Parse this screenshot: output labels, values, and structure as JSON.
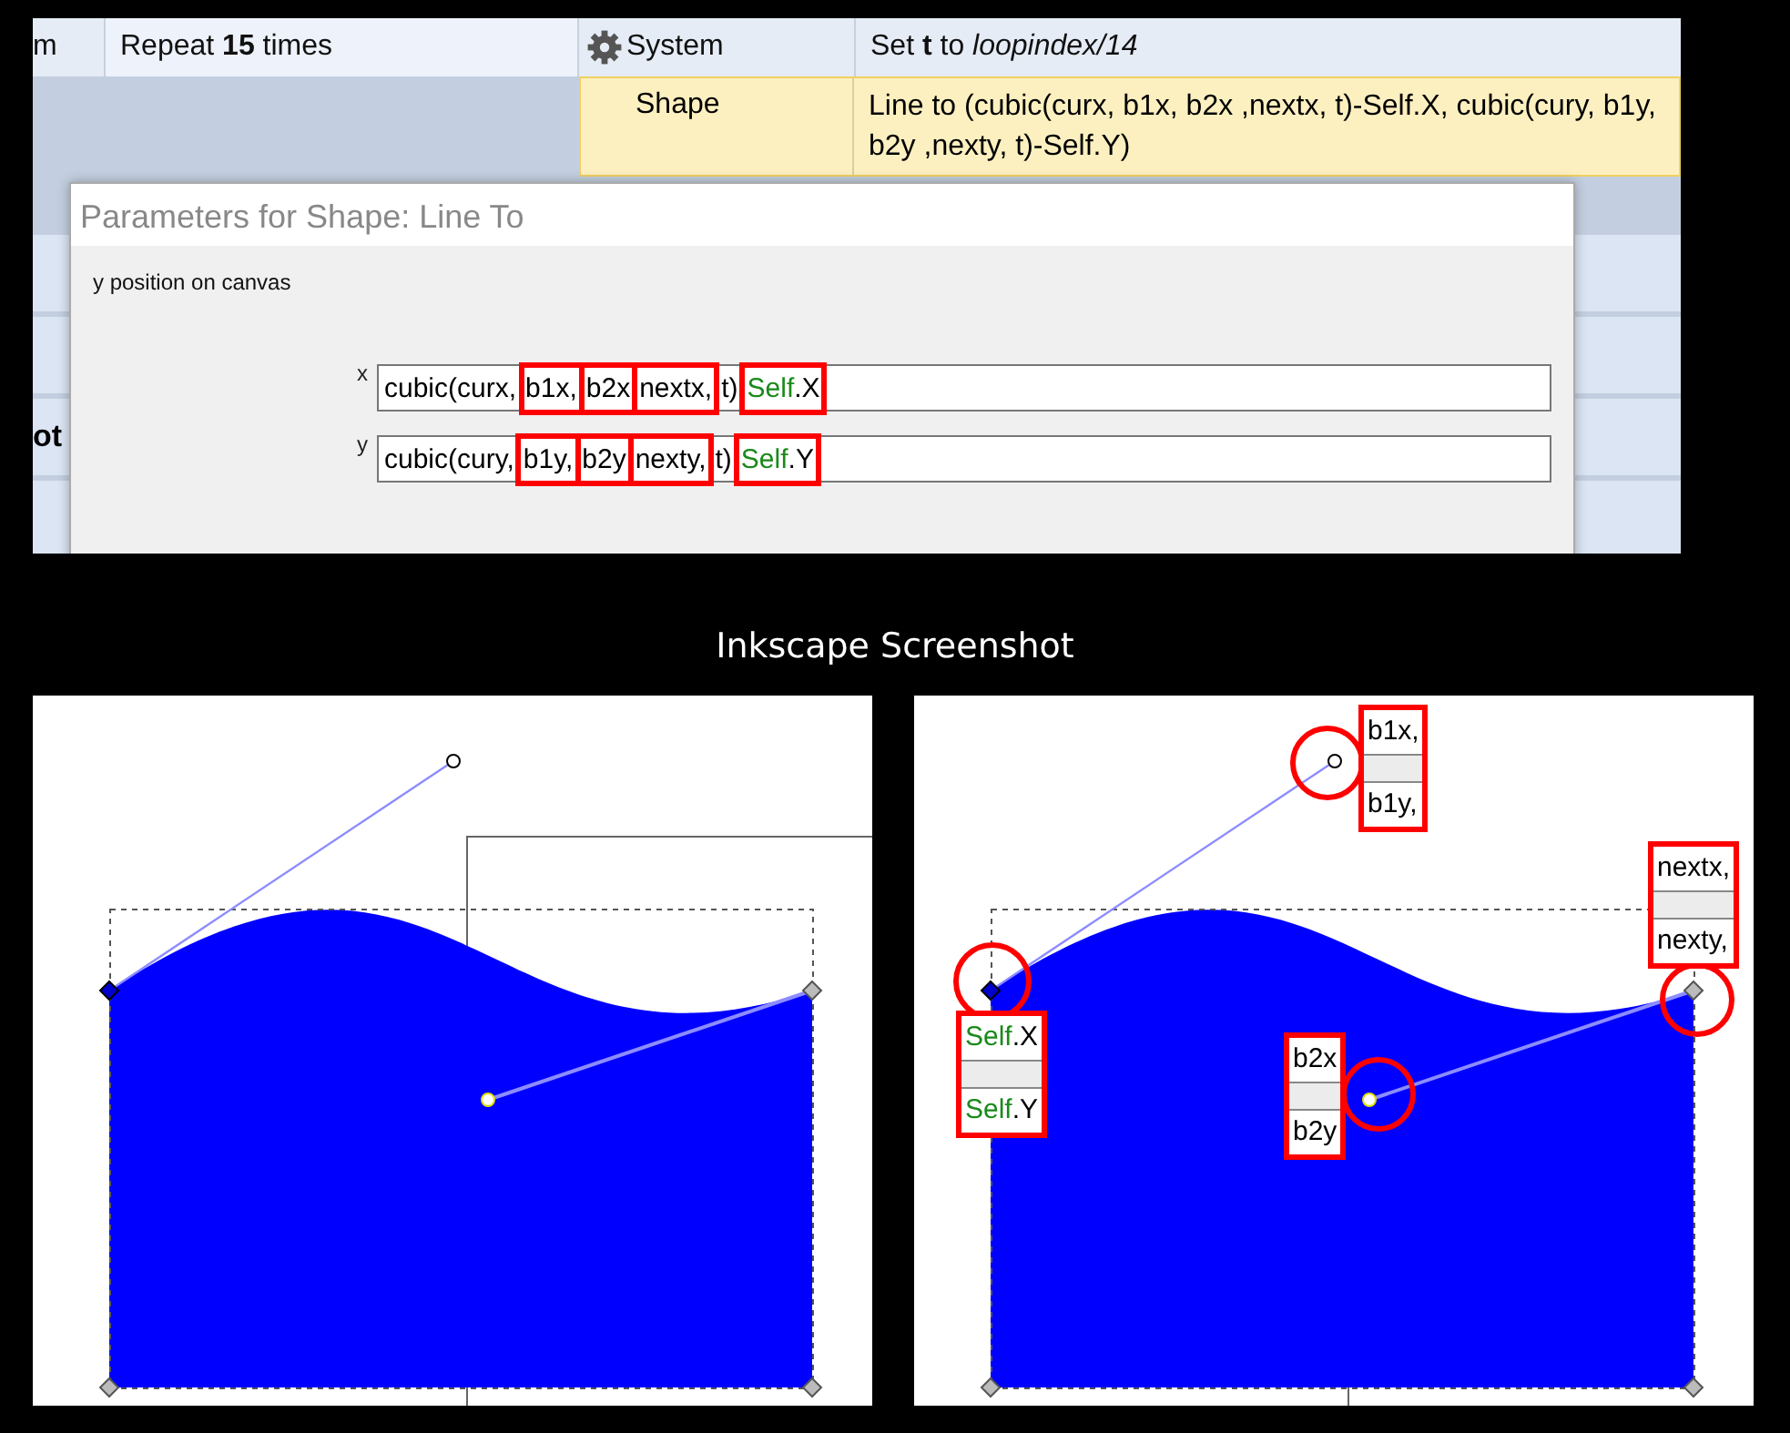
{
  "event_sheet": {
    "condition_row": {
      "column_1": "m",
      "condition": "Repeat **15** times",
      "object": "System",
      "action": "Set **t** to *loopindex/14*"
    },
    "action_row": {
      "object": "Shape",
      "action": "Line to (cubic(curx, b1x, b2x ,nextx, t)-Self.X, cubic(cury, b1y, b2y ,nexty, t)-Self.Y)",
      "selected": true
    },
    "background_text": "ot"
  },
  "dialog": {
    "title": "Parameters for Shape: Line To",
    "description": "y position on canvas",
    "fields": [
      {
        "label": "x",
        "segments": [
          {
            "boxed": false,
            "parts": [
              {
                "text": "cubic(curx,",
                "kind": "plain"
              }
            ]
          },
          {
            "boxed": true,
            "parts": [
              {
                "text": "b1x,",
                "kind": "plain"
              }
            ]
          },
          {
            "boxed": true,
            "parts": [
              {
                "text": "b2x",
                "kind": "plain"
              }
            ]
          },
          {
            "boxed": true,
            "parts": [
              {
                "text": "nextx,",
                "kind": "plain"
              }
            ]
          },
          {
            "boxed": false,
            "parts": [
              {
                "text": "t)",
                "kind": "plain"
              }
            ]
          },
          {
            "boxed": true,
            "parts": [
              {
                "text": "Self",
                "kind": "object"
              },
              {
                "text": ".X",
                "kind": "plain"
              }
            ]
          }
        ]
      },
      {
        "label": "y",
        "segments": [
          {
            "boxed": false,
            "parts": [
              {
                "text": "cubic(cury,",
                "kind": "plain"
              }
            ]
          },
          {
            "boxed": true,
            "parts": [
              {
                "text": "b1y,",
                "kind": "plain"
              }
            ]
          },
          {
            "boxed": true,
            "parts": [
              {
                "text": "b2y",
                "kind": "plain"
              }
            ]
          },
          {
            "boxed": true,
            "parts": [
              {
                "text": "nexty,",
                "kind": "plain"
              }
            ]
          },
          {
            "boxed": false,
            "parts": [
              {
                "text": "t)",
                "kind": "plain"
              }
            ]
          },
          {
            "boxed": true,
            "parts": [
              {
                "text": "Self",
                "kind": "object"
              },
              {
                "text": ".Y",
                "kind": "plain"
              }
            ]
          }
        ]
      }
    ]
  },
  "caption": "Inkscape Screenshot",
  "canvases": [
    {
      "annotated": false
    },
    {
      "annotated": true,
      "labels": [
        {
          "lines": [
            [
              {
                "text": "b1x,",
                "kind": "plain"
              }
            ],
            [
              {
                "text": "b1y,",
                "kind": "plain"
              }
            ]
          ]
        },
        {
          "lines": [
            [
              {
                "text": "nextx,",
                "kind": "plain"
              }
            ],
            [
              {
                "text": "nexty,",
                "kind": "plain"
              }
            ]
          ]
        },
        {
          "lines": [
            [
              {
                "text": "Self",
                "kind": "object"
              },
              {
                "text": ".X",
                "kind": "plain"
              }
            ],
            [
              {
                "text": "Self",
                "kind": "object"
              },
              {
                "text": ".Y",
                "kind": "plain"
              }
            ]
          ]
        },
        {
          "lines": [
            [
              {
                "text": "b2x",
                "kind": "plain"
              }
            ],
            [
              {
                "text": "b2y",
                "kind": "plain"
              }
            ]
          ]
        }
      ]
    }
  ]
}
